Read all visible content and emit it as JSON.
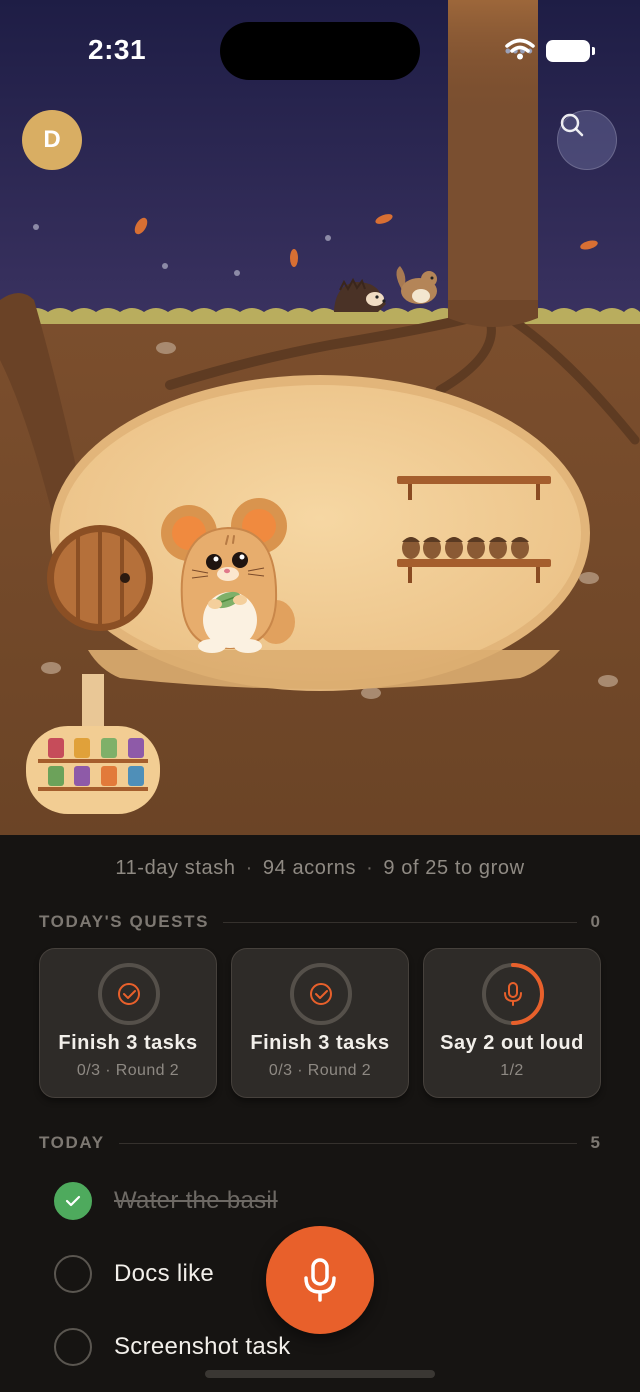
{
  "status_bar": {
    "time": "2:31",
    "signal": "••••"
  },
  "header": {
    "avatar_initial": "D",
    "search_icon": "search-icon"
  },
  "colors": {
    "sky": "#24244d",
    "soil": "#7a4d2c",
    "burrow": "#f1c98d",
    "accent": "#e8602b",
    "done_green": "#4eaa5d",
    "sheet_bg": "#161412",
    "card_bg": "#2e2b28"
  },
  "stats": {
    "stash": "11-day stash",
    "acorns": "94 acorns",
    "grow": "9 of 25 to grow",
    "separator": "·"
  },
  "quests_section": {
    "title": "TODAY'S QUESTS",
    "count": "0",
    "items": [
      {
        "title": "Finish 3 tasks",
        "sub": "0/3 · Round 2",
        "icon": "check-circle-icon",
        "progress": 0
      },
      {
        "title": "Finish 3 tasks",
        "sub": "0/3 · Round 2",
        "icon": "check-circle-icon",
        "progress": 0
      },
      {
        "title": "Say 2 out loud",
        "sub": "1/2",
        "icon": "mic-icon",
        "progress": 0.5
      }
    ]
  },
  "today_section": {
    "title": "TODAY",
    "count": "5",
    "tasks": [
      {
        "label": "Water the basil",
        "done": true
      },
      {
        "label": "Docs like",
        "done": false
      },
      {
        "label": "Screenshot task",
        "done": false
      }
    ]
  },
  "fab": {
    "icon": "mic-icon"
  }
}
